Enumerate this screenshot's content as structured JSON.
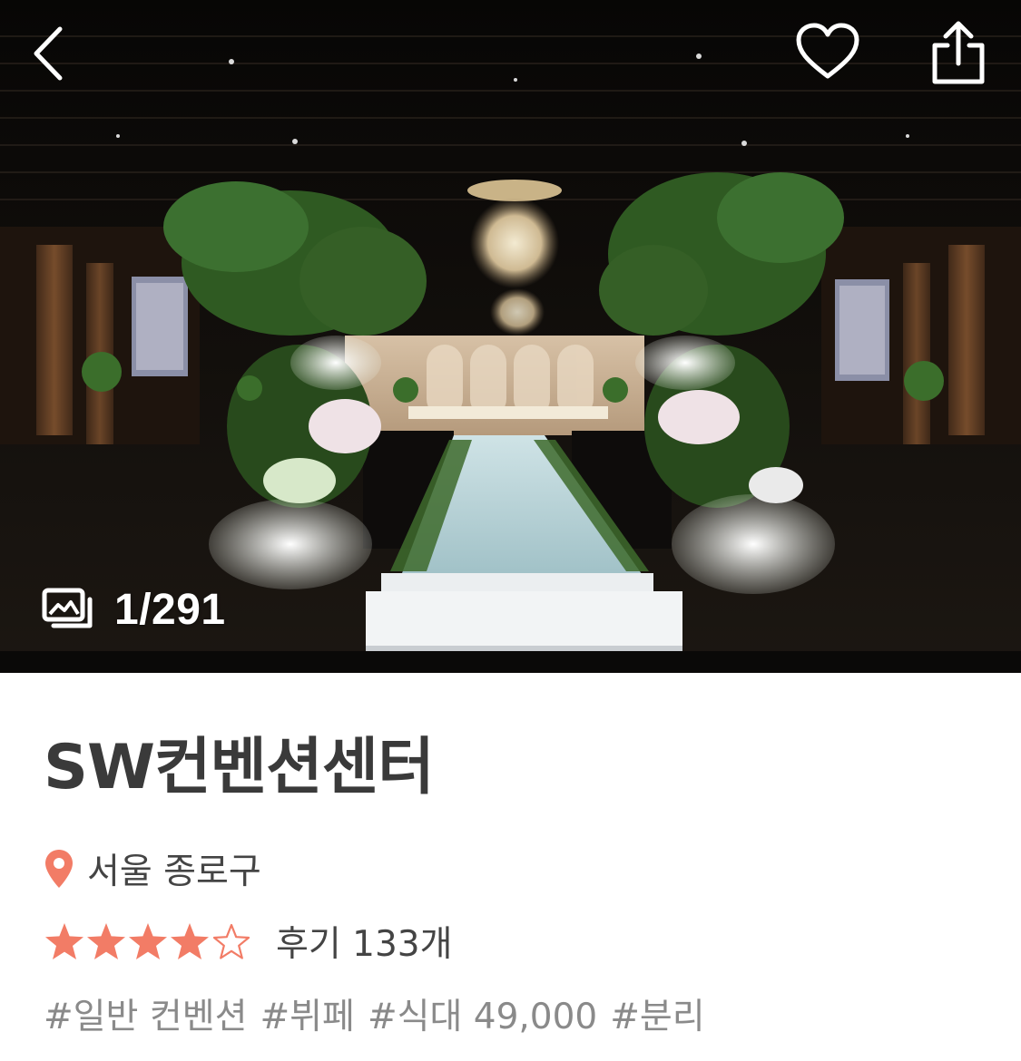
{
  "hero": {
    "photo_alt": "wedding hall",
    "counter": "1/291"
  },
  "venue": {
    "name": "SW컨벤션센터",
    "location": "서울 종로구",
    "rating": 4,
    "rating_max": 5,
    "review_label": "후기 133개",
    "tags": [
      "#일반 컨벤션",
      "#뷔페",
      "#식대 49,000",
      "#분리"
    ]
  },
  "icons": {
    "back": "chevron-left-icon",
    "like": "heart-icon",
    "share": "share-icon",
    "gallery": "gallery-icon",
    "location": "location-pin-icon",
    "star": "star-icon"
  },
  "colors": {
    "accent": "#F27C66",
    "title": "#3A3A3A",
    "body": "#444444",
    "muted": "#8A8A8A"
  }
}
